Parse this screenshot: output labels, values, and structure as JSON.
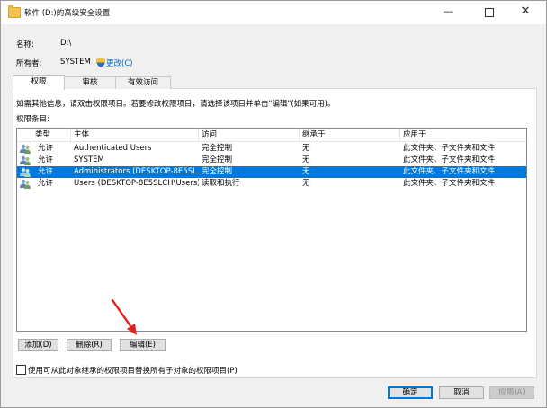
{
  "window": {
    "title": "软件 (D:)的高级安全设置"
  },
  "summary": {
    "name_label": "名称:",
    "name_value": "D:\\",
    "owner_label": "所有者:",
    "owner_value": "SYSTEM",
    "change_link": "更改(C)"
  },
  "tabs": [
    {
      "label": "权限"
    },
    {
      "label": "审核"
    },
    {
      "label": "有效访问"
    }
  ],
  "info_text": "如需其他信息，请双击权限项目。若要修改权限项目，请选择该项目并单击\"编辑\"(如果可用)。",
  "entries_label": "权限条目:",
  "columns": [
    "类型",
    "主体",
    "访问",
    "继承于",
    "应用于"
  ],
  "rows": [
    {
      "type": "允许",
      "principal": "Authenticated Users",
      "access": "完全控制",
      "inherited": "无",
      "applies": "此文件夹、子文件夹和文件"
    },
    {
      "type": "允许",
      "principal": "SYSTEM",
      "access": "完全控制",
      "inherited": "无",
      "applies": "此文件夹、子文件夹和文件"
    },
    {
      "type": "允许",
      "principal": "Administrators (DESKTOP-8E5SL...",
      "access": "完全控制",
      "inherited": "无",
      "applies": "此文件夹、子文件夹和文件"
    },
    {
      "type": "允许",
      "principal": "Users (DESKTOP-8E5SLCH\\Users)",
      "access": "读取和执行",
      "inherited": "无",
      "applies": "此文件夹、子文件夹和文件"
    }
  ],
  "selected_row_index": 2,
  "buttons": {
    "add": "添加(D)",
    "remove": "删除(R)",
    "edit": "编辑(E)",
    "ok": "确定",
    "cancel": "取消",
    "apply": "应用(A)"
  },
  "replace_checkbox_label": "使用可从此对象继承的权限项目替换所有子对象的权限项目(P)",
  "colors": {
    "selection": "#0078d7",
    "link": "#0066cc",
    "arrow": "#e02020"
  }
}
